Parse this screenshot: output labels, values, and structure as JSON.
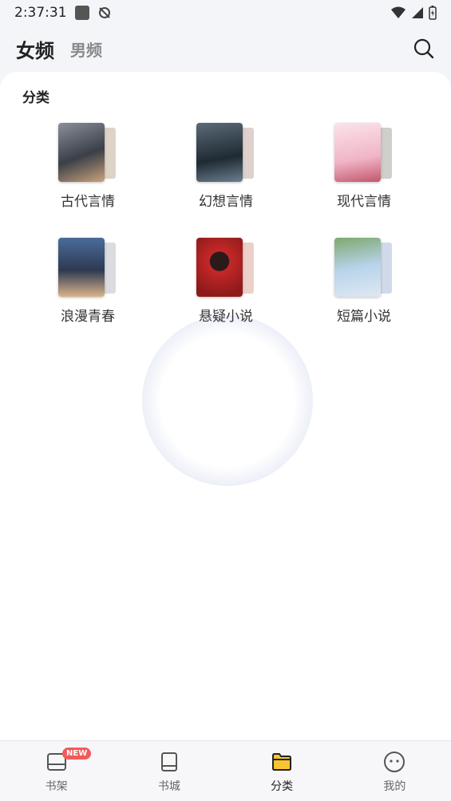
{
  "status_bar": {
    "time": "2:37:31"
  },
  "header": {
    "tab_active": "女频",
    "tab_inactive": "男频"
  },
  "section": {
    "title": "分类"
  },
  "categories": [
    {
      "label": "古代言情",
      "icon": "book-cover-ancient",
      "color": "#4a4f5a",
      "accent": "#c9a27a"
    },
    {
      "label": "幻想言情",
      "icon": "book-cover-fantasy",
      "color": "#2b3640",
      "accent": "#9fb2c4"
    },
    {
      "label": "现代言情",
      "icon": "book-cover-modern",
      "color": "#f3c9d6",
      "accent": "#c2566e"
    },
    {
      "label": "浪漫青春",
      "icon": "book-cover-youth",
      "color": "#3b4f6e",
      "accent": "#d9b48a"
    },
    {
      "label": "悬疑小说",
      "icon": "book-cover-mystery",
      "color": "#b52222",
      "accent": "#2a1a1a"
    },
    {
      "label": "短篇小说",
      "icon": "book-cover-short",
      "color": "#a9c7e6",
      "accent": "#6f8f6a"
    }
  ],
  "bottom_nav": {
    "items": [
      {
        "label": "书架",
        "icon": "bookshelf-icon",
        "badge": "NEW"
      },
      {
        "label": "书城",
        "icon": "book-icon"
      },
      {
        "label": "分类",
        "icon": "folder-icon"
      },
      {
        "label": "我的",
        "icon": "profile-face-icon"
      }
    ],
    "active_index": 2,
    "active_color": "#f7c531"
  }
}
